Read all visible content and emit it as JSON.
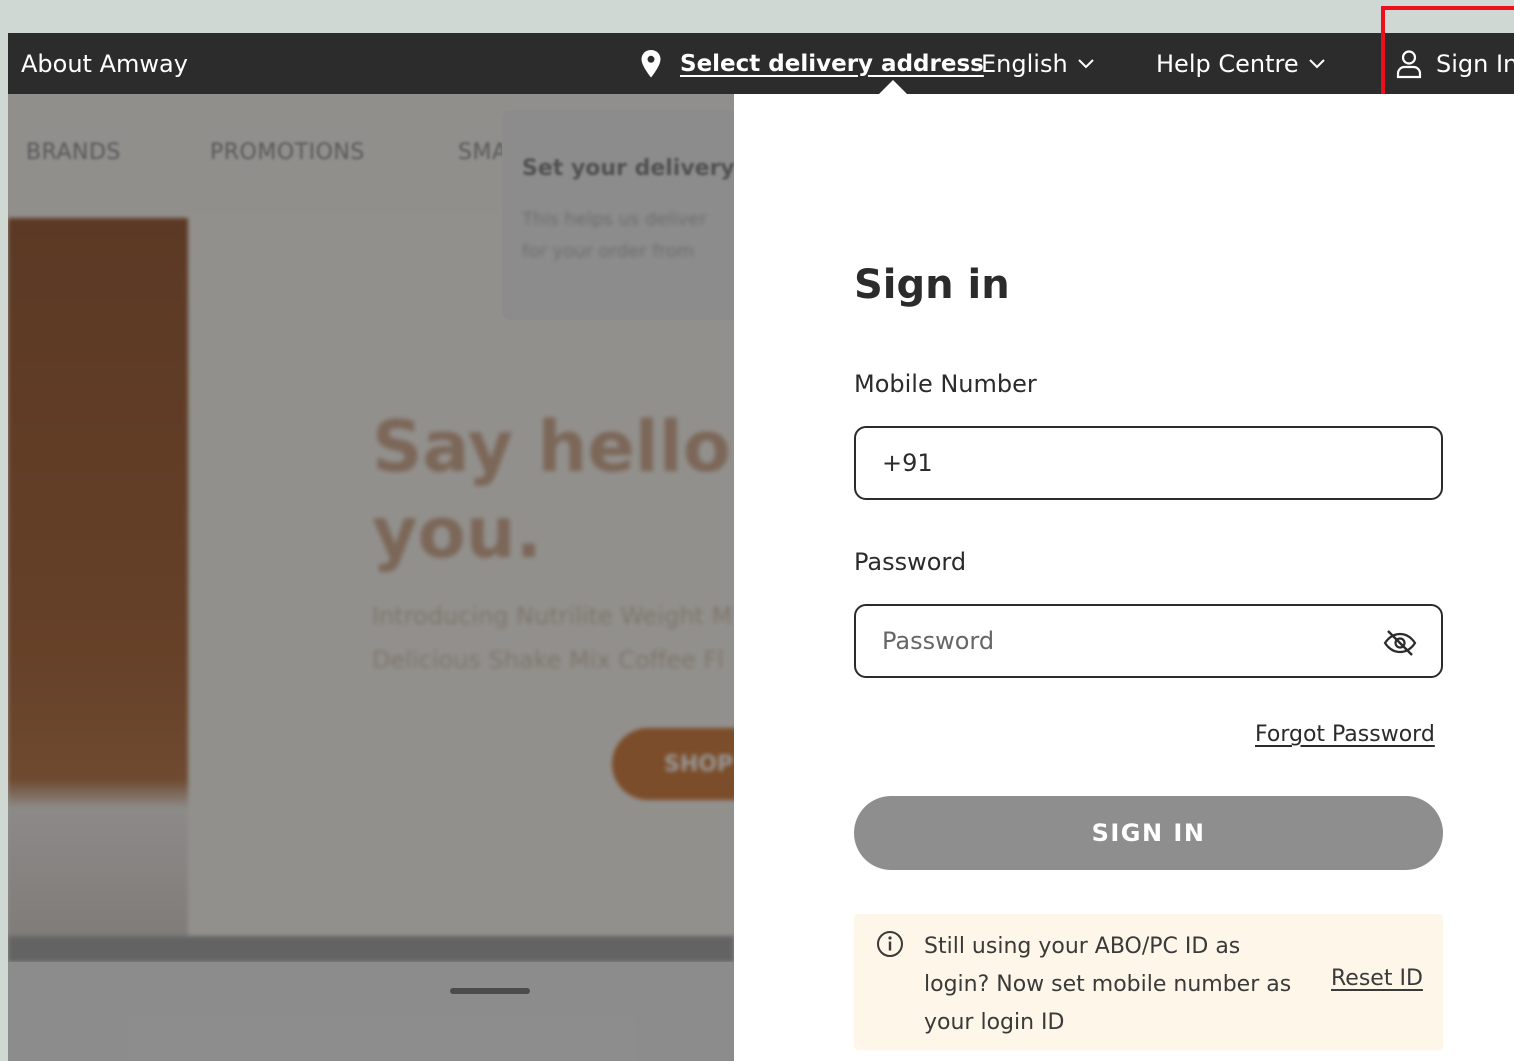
{
  "topbar": {
    "about": "About Amway",
    "delivery": "Select delivery address",
    "language": "English",
    "help": "Help Centre",
    "signin": "Sign In"
  },
  "background": {
    "nav": [
      "BRANDS",
      "PROMOTIONS",
      "SMA"
    ],
    "tooltip_title": "Set your delivery l",
    "tooltip_line1": "This helps us deliver",
    "tooltip_line2": "for your order from",
    "hero_line1": "Say hello to",
    "hero_line2": "you.",
    "hero_sub1": "Introducing Nutrilite Weight M",
    "hero_sub2": "Delicious Shake Mix Coffee Fl",
    "shop": "SHOP"
  },
  "signin": {
    "title": "Sign in",
    "mobile_label": "Mobile Number",
    "mobile_value": "+91",
    "password_label": "Password",
    "password_placeholder": "Password",
    "forgot": "Forgot Password",
    "button": "SIGN IN",
    "notice_text": "Still using your ABO/PC ID as login? Now set mobile number as your login ID",
    "reset": "Reset ID"
  },
  "colors": {
    "topbar_bg": "#2c2c2c",
    "highlight": "#ee0f1c",
    "button_disabled": "#8e8e8e",
    "notice_bg": "#fdf6e9"
  }
}
